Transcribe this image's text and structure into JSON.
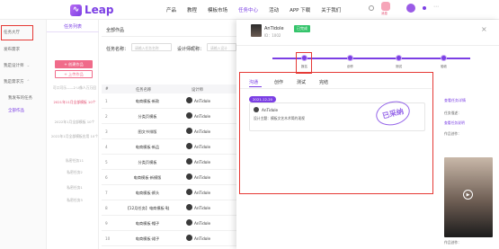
{
  "topbar": {
    "logo_text": "Leap",
    "nav": [
      "产品",
      "教程",
      "模板市场",
      "任务中心",
      "活动",
      "APP 下载",
      "关于我们"
    ],
    "badge": "消息"
  },
  "sidebar": {
    "items": [
      "任务大厅",
      "发布需求",
      "我是设计师",
      "我是需求方",
      "我发布的任务",
      "全部作品"
    ]
  },
  "categories": {
    "header": "任务列表",
    "primary_button": "+ 创建作品",
    "outline_button": "+ 上传作品",
    "items": [
      "可口可乐——2 U像人万万回",
      "2021年11月全部模板 10个",
      "2022年1月全部模板 10个",
      "2022年1月全部模板应用 10个",
      "私密任务11",
      "私密任务2",
      "私密任务1",
      "私密任务3"
    ]
  },
  "main": {
    "title": "全部作品",
    "filter_task_label": "任务名称：",
    "filter_task_placeholder": "请输入任务名称",
    "filter_designer_label": "设计师昵称：",
    "filter_designer_placeholder": "请输入设计",
    "headers": [
      "#",
      "任务名称",
      "设计师"
    ],
    "rows": [
      {
        "num": "1",
        "name": "电商模板·新款",
        "designer": "AnTidole"
      },
      {
        "num": "2",
        "name": "分类页模板",
        "designer": "AnTidole"
      },
      {
        "num": "3",
        "name": "图文书排版",
        "designer": "AnTidole"
      },
      {
        "num": "4",
        "name": "电商模板·新品",
        "designer": "AnTidole"
      },
      {
        "num": "5",
        "name": "分类页模板",
        "designer": "AnTidole"
      },
      {
        "num": "6",
        "name": "电商模板·新模版",
        "designer": "AnTidole"
      },
      {
        "num": "7",
        "name": "电商模板·裤头",
        "designer": "AnTidole"
      },
      {
        "num": "8",
        "name": "【12月任务】电商模板·鞋",
        "designer": "AnTidole"
      },
      {
        "num": "9",
        "name": "电商模板·帽子",
        "designer": "AnTidole"
      },
      {
        "num": "10",
        "name": "电商模板·裙子",
        "designer": "AnTidole"
      }
    ]
  },
  "panel": {
    "name": "AnTidole",
    "status": "已完成",
    "id": "ID：1002",
    "steps": [
      "报名",
      "创作",
      "测试",
      "验收"
    ],
    "tabs": [
      "沟通",
      "创作",
      "测试",
      "完结"
    ],
    "date": "2021-12-20",
    "comment_author": "AnTidole",
    "comment_text": "设计主题：模板文艺木术简约现视",
    "stamp": "已采纳",
    "right": {
      "title": "查看任务详情",
      "label1": "任务描述：",
      "link": "查看任务说明",
      "label2": "作品创作：",
      "bottom": "作品创作："
    }
  }
}
